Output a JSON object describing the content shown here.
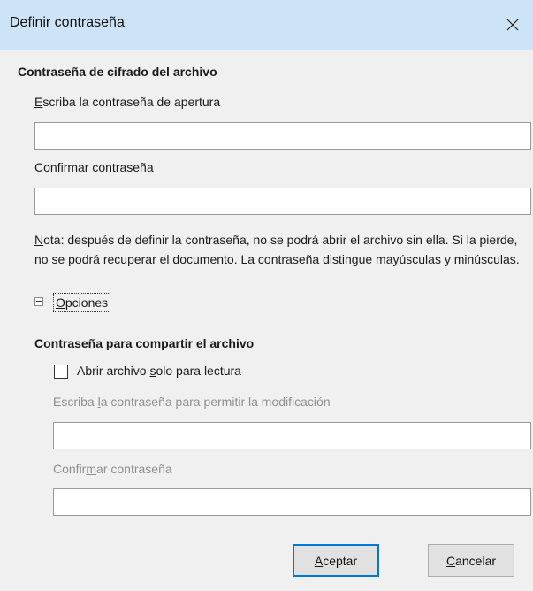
{
  "window": {
    "title": "Definir contraseña"
  },
  "encryption": {
    "heading": "Contraseña de cifrado del archivo",
    "open_label": {
      "mnemonic": "E",
      "rest": "scriba la contraseña de apertura"
    },
    "open_value": "",
    "confirm_label": {
      "pre": "Con",
      "mnemonic": "f",
      "rest": "irmar contraseña"
    },
    "confirm_value": "",
    "note": {
      "mnemonic": "N",
      "rest": "ota: después de definir la contraseña, no se podrá abrir el archivo sin ella. Si la pierde, no se podrá recuperar el documento. La contraseña distingue mayúsculas y minúsculas."
    }
  },
  "options": {
    "mnemonic": "O",
    "rest": "pciones",
    "expanded": true
  },
  "sharing": {
    "heading": "Contraseña para compartir el archivo",
    "readonly": {
      "pre": "Abrir archivo ",
      "mnemonic": "s",
      "rest": "olo para lectura",
      "checked": false
    },
    "modify_label": {
      "pre": "Escriba ",
      "mnemonic": "l",
      "rest": "a contraseña para permitir la modificación"
    },
    "modify_value": "",
    "confirm_label": {
      "pre": "Confir",
      "mnemonic": "m",
      "rest": "ar contraseña"
    },
    "confirm_value": ""
  },
  "buttons": {
    "ok": {
      "mnemonic": "A",
      "rest": "ceptar"
    },
    "cancel": {
      "mnemonic": "C",
      "rest": "ancelar"
    }
  },
  "icons": {
    "close": "close-icon",
    "expander": "collapse-icon"
  }
}
